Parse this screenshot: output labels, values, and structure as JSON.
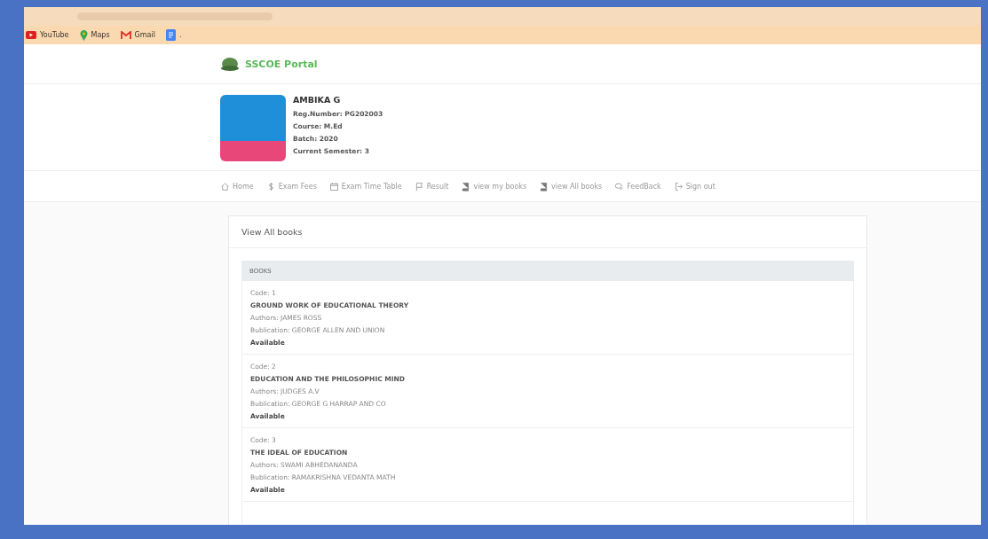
{
  "bookmarks": [
    {
      "label": "YouTube",
      "kind": "youtube"
    },
    {
      "label": "Maps",
      "kind": "maps"
    },
    {
      "label": "Gmail",
      "kind": "gmail"
    },
    {
      "label": ".",
      "kind": "docs"
    }
  ],
  "brand": {
    "title": "SSCOE Portal"
  },
  "student": {
    "name": "AMBIKA G",
    "details": [
      "Reg.Number: PG202003",
      "Course: M.Ed",
      "Batch: 2020",
      "Current Semester: 3"
    ]
  },
  "nav": [
    {
      "label": "Home",
      "kind": "home"
    },
    {
      "label": "Exam Fees",
      "kind": "dollar"
    },
    {
      "label": "Exam Time Table",
      "kind": "calendar"
    },
    {
      "label": "Result",
      "kind": "flag"
    },
    {
      "label": "view my books",
      "kind": "book"
    },
    {
      "label": "view All books",
      "kind": "book"
    },
    {
      "label": "FeedBack",
      "kind": "chat"
    },
    {
      "label": "Sign out",
      "kind": "signout"
    }
  ],
  "card": {
    "title": "View All books",
    "table_header": "BOOKS",
    "books": [
      {
        "code": "Code: 1",
        "title": "GROUND WORK OF EDUCATIONAL THEORY",
        "authors": "Authors: JAMES ROSS",
        "publication": "Bublication: GEORGE ALLEN AND UNION",
        "status": "Available"
      },
      {
        "code": "Code: 2",
        "title": "EDUCATION AND THE PHILOSOPHIC MIND",
        "authors": "Authors: JUDGES A.V",
        "publication": "Bublication: GEORGE G HARRAP AND CO",
        "status": "Available"
      },
      {
        "code": "Code: 3",
        "title": "THE IDEAL OF EDUCATION",
        "authors": "Authors: SWAMI ABHEDANANDA",
        "publication": "Bublication: RAMAKRISHNA VEDANTA MATH",
        "status": "Available"
      }
    ]
  }
}
